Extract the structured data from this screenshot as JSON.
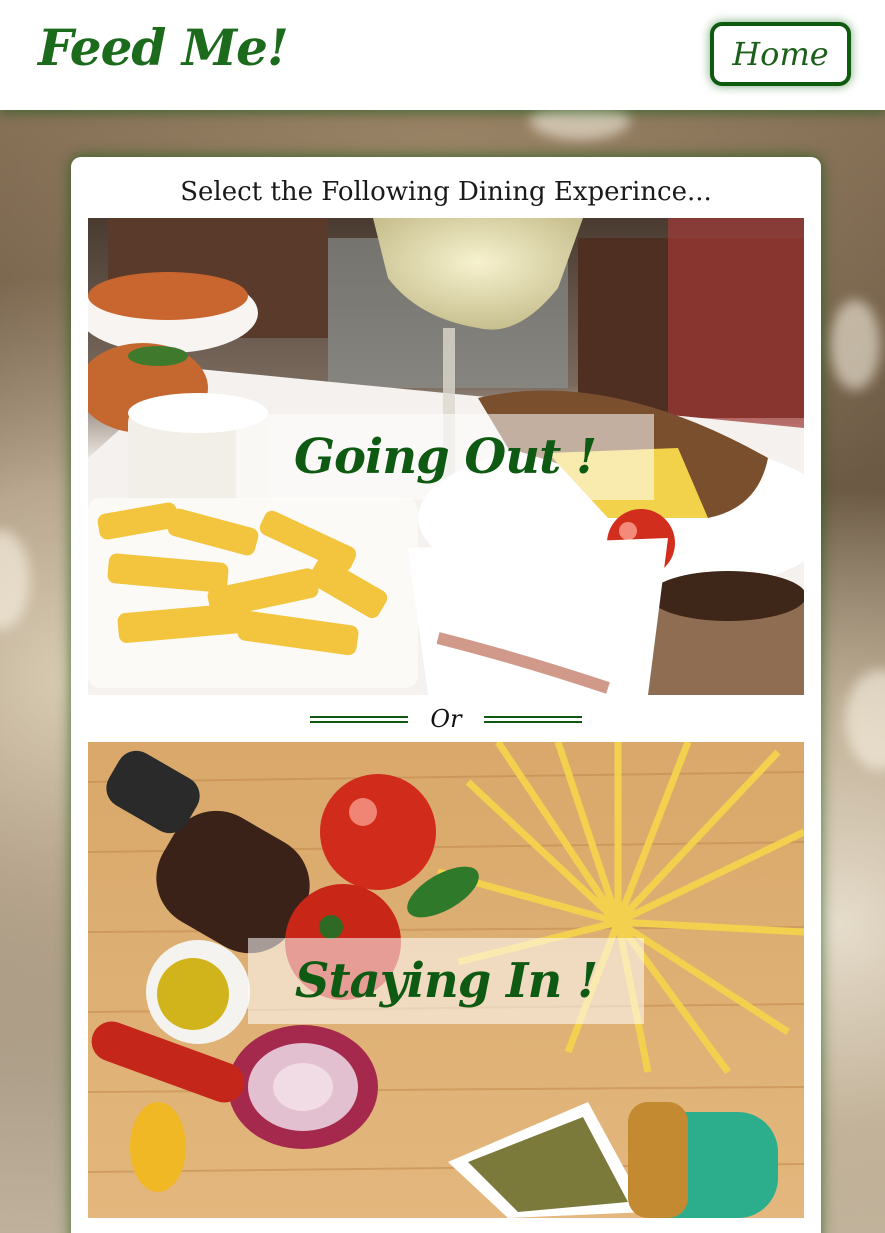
{
  "header": {
    "brand": "Feed Me!",
    "home_label": "Home"
  },
  "main": {
    "title": "Select the Following Dining Experince...",
    "options": [
      {
        "label": "Going Out !"
      },
      {
        "label": "Staying In !"
      }
    ],
    "divider_label": "Or"
  },
  "colors": {
    "brand_green": "#1c6b1c",
    "button_border": "#0e5a0e",
    "card_bg": "#ffffff"
  }
}
